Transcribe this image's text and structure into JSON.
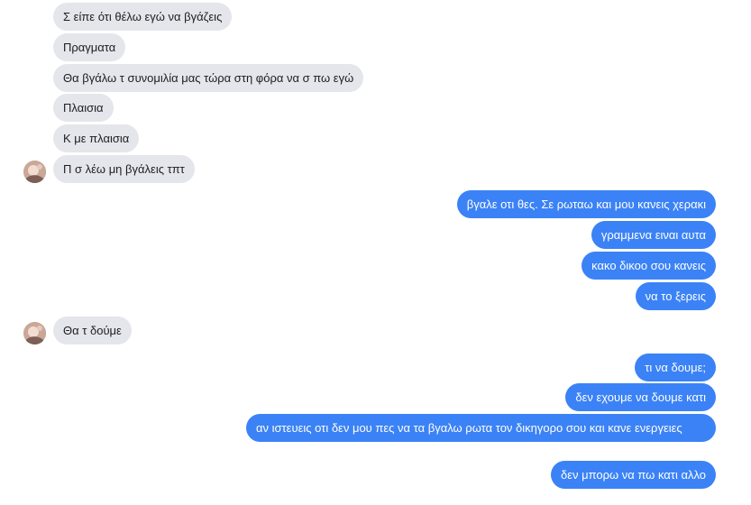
{
  "messages": [
    {
      "side": "in",
      "text": "Σ είπε ότι θέλω εγώ να βγάζεις"
    },
    {
      "side": "in",
      "text": "Πραγματα"
    },
    {
      "side": "in",
      "text": "Θα βγάλω τ συνομιλία μας τώρα στη φόρα να σ πω εγώ"
    },
    {
      "side": "in",
      "text": "Πλαισια"
    },
    {
      "side": "in",
      "text": "Κ με πλαισια"
    },
    {
      "side": "in",
      "text": "Π σ λέω μη βγάλεις τπτ"
    },
    {
      "side": "out",
      "text": "βγαλε οτι θες. Σε ρωταω και μου κανεις χερακι"
    },
    {
      "side": "out",
      "text": "γραμμενα ειναι αυτα"
    },
    {
      "side": "out",
      "text": "κακο δικοο σου κανεις"
    },
    {
      "side": "out",
      "text": "να το ξερεις"
    },
    {
      "side": "in",
      "text": "Θα τ δούμε"
    },
    {
      "side": "out",
      "text": "τι να δουμε;"
    },
    {
      "side": "out",
      "text": "δεν εχουμε να δουμε κατι"
    },
    {
      "side": "out",
      "text": "αν ιστευεις οτι δεν μου πες να τα βγαλω ρωτα τον δικηγορο σου και κανε ενεργειες"
    },
    {
      "side": "out",
      "text": "δεν μπορω να πω κατι αλλο"
    }
  ],
  "avatars": [
    {
      "icon": "contact-avatar"
    },
    {
      "icon": "contact-avatar"
    }
  ]
}
